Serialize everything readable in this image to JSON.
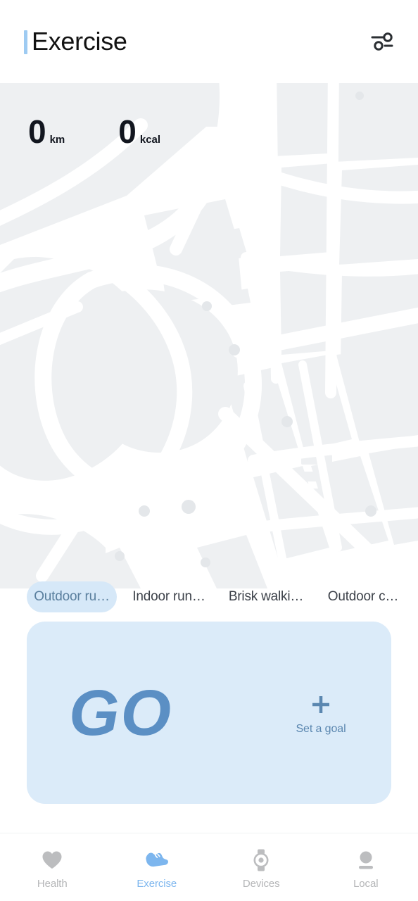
{
  "header": {
    "title": "Exercise",
    "accent_color": "#9ecbf2",
    "settings_icon": "sliders-icon"
  },
  "stats": [
    {
      "value": "0",
      "unit": "km"
    },
    {
      "value": "0",
      "unit": "kcal"
    }
  ],
  "sport_chips": [
    {
      "label": "Outdoor ru…",
      "selected": true
    },
    {
      "label": "Indoor run…",
      "selected": false
    },
    {
      "label": "Brisk walki…",
      "selected": false
    },
    {
      "label": "Outdoor c…",
      "selected": false
    }
  ],
  "go_card": {
    "go_label": "GO",
    "goal_label": "Set a goal",
    "plus_icon": "plus-icon",
    "background_color": "#dbebf9",
    "text_color": "#5b8fc4"
  },
  "bottom_nav": {
    "active_color": "#7db6ee",
    "inactive_color": "#b4b5b7",
    "items": [
      {
        "label": "Health",
        "icon": "heart-icon",
        "active": false
      },
      {
        "label": "Exercise",
        "icon": "running-shoe-icon",
        "active": true
      },
      {
        "label": "Devices",
        "icon": "smartwatch-icon",
        "active": false
      },
      {
        "label": "Local",
        "icon": "person-icon",
        "active": false
      }
    ]
  },
  "map": {
    "road_color": "#ffffff",
    "land_color": "#eff1f3",
    "block_color": "#e9ecef"
  }
}
